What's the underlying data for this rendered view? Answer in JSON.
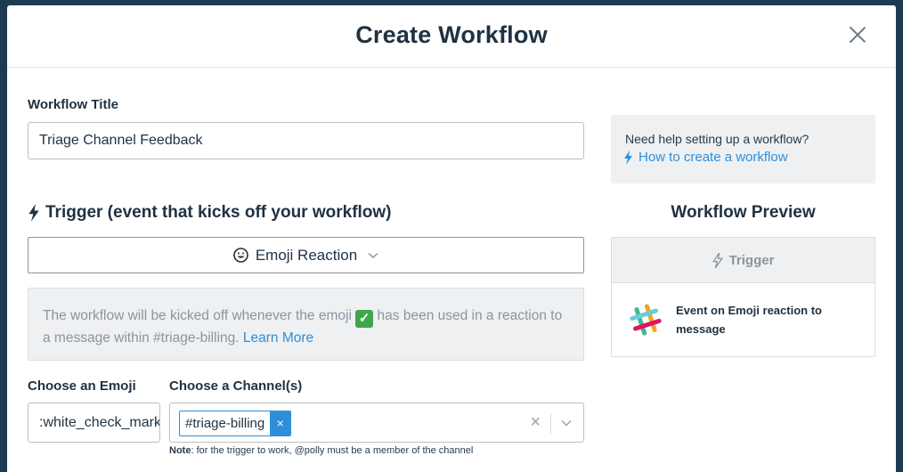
{
  "modal": {
    "title": "Create Workflow"
  },
  "form": {
    "title_label": "Workflow Title",
    "title_value": "Triage Channel Feedback",
    "trigger_heading": "Trigger (event that kicks off your workflow)",
    "trigger_select": "Emoji Reaction",
    "info_text_before": "The workflow will be kicked off whenever the emoji",
    "info_text_after": "has been used in a reaction to a message within #triage-billing.",
    "info_link": "Learn More",
    "emoji_label": "Choose an Emoji",
    "emoji_value": ":white_check_mark:",
    "channel_label": "Choose a Channel(s)",
    "channel_tag": "#triage-billing",
    "channel_tag_remove": "×",
    "note_bold": "Note",
    "note_text": ": for the trigger to work, @polly must be a member of the channel"
  },
  "help": {
    "text": "Need help setting up a workflow?",
    "link": "How to create a workflow"
  },
  "preview": {
    "title": "Workflow Preview",
    "trigger_label": "Trigger",
    "event_text": "Event on Emoji reaction to message"
  },
  "icons": {
    "close": "close-icon",
    "bolt": "lightning-bolt-icon",
    "emoji": "smiley-icon",
    "chevron": "chevron-down-icon",
    "slack": "slack-logo-icon"
  },
  "colors": {
    "accent": "#2d8fd9",
    "heading": "#1f3142",
    "muted": "#8a959f",
    "panel": "#eef0f2",
    "success": "#3ea64b"
  }
}
